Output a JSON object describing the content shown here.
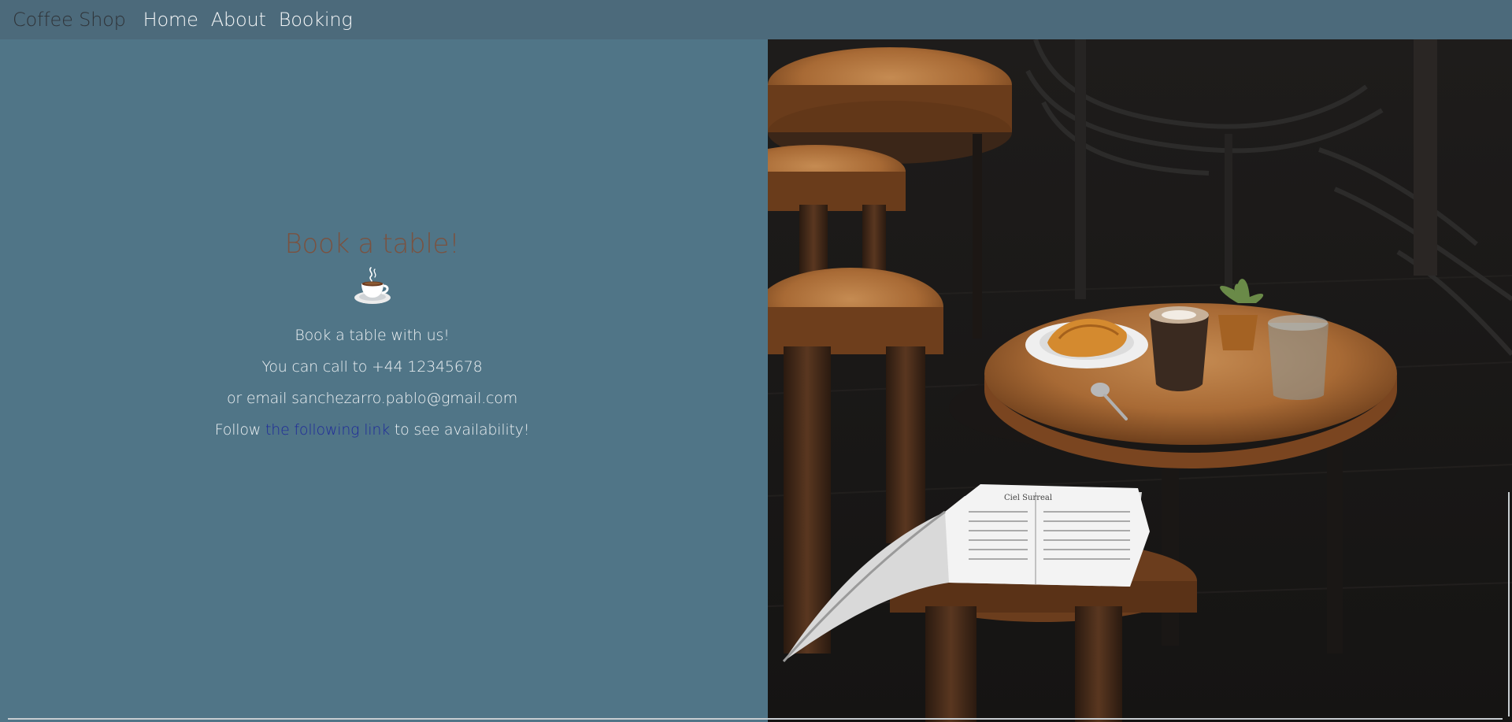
{
  "navbar": {
    "brand": "Coffee Shop",
    "links": [
      "Home",
      "About",
      "Booking"
    ]
  },
  "booking": {
    "title": "Book a table!",
    "icon": "coffee-cup-icon",
    "line1": "Book a table with us!",
    "line2": "You can call to +44 12345678",
    "line3": "or email sanchezarro.pablo@gmail.com",
    "line4_prefix": "Follow ",
    "line4_link": "the following link",
    "line4_suffix": " to see availability!"
  },
  "photo_book_heading": "Ciel Surreal",
  "colors": {
    "navbar_bg": "#4c6a7b",
    "page_bg": "#507587",
    "title": "#7a5240",
    "link": "#1e2a9a"
  }
}
